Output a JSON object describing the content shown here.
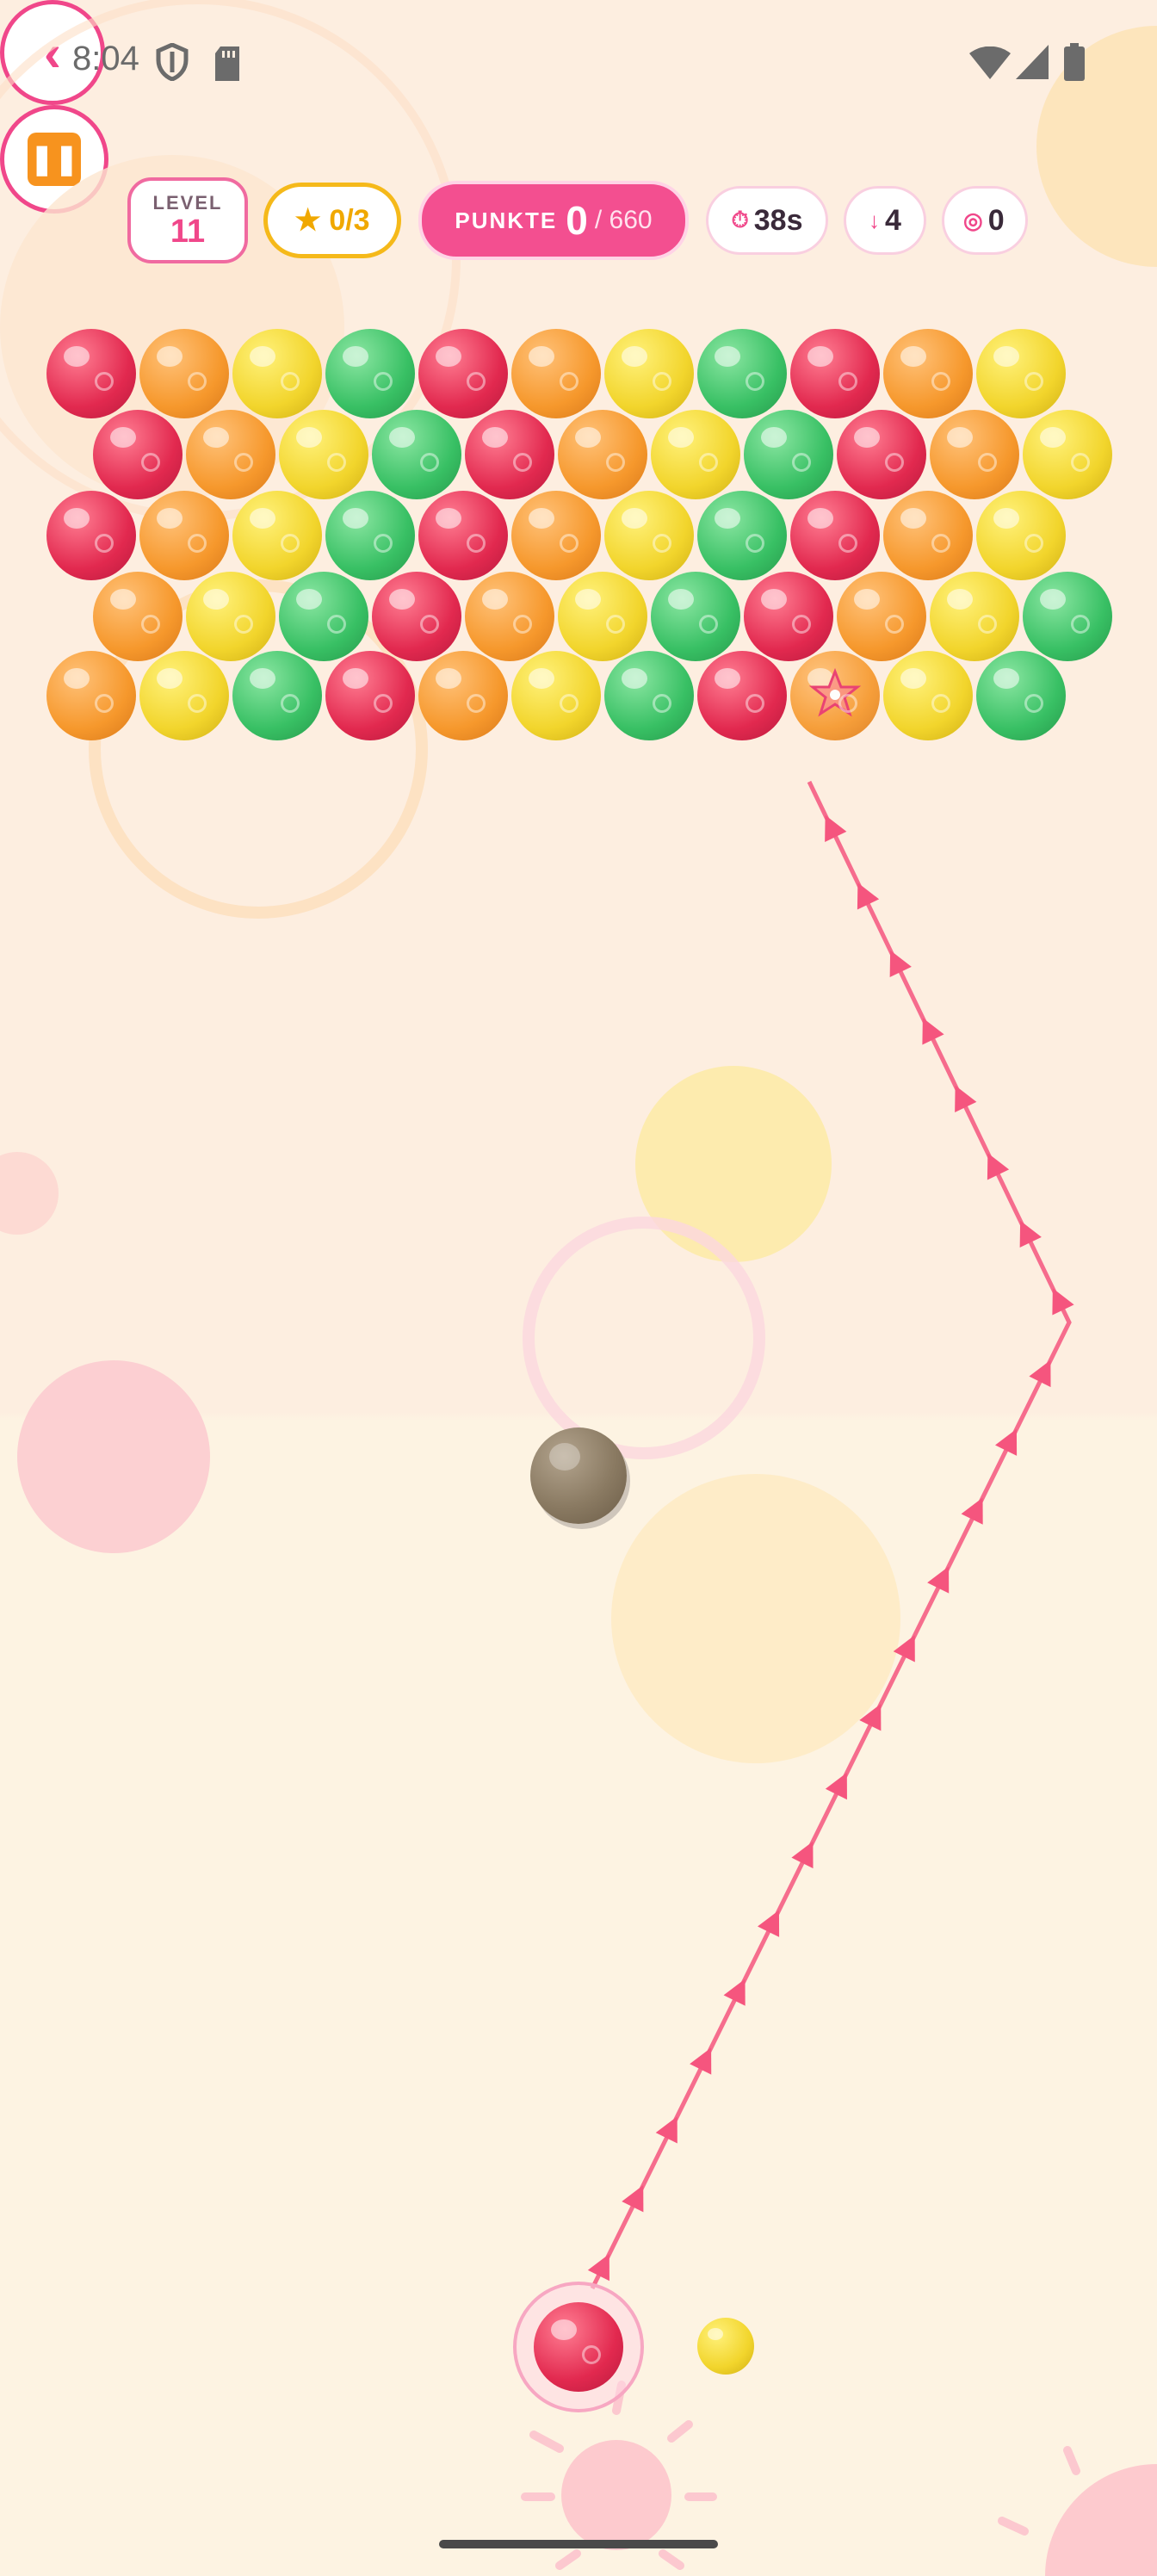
{
  "status_bar": {
    "time": "8:04",
    "icons": [
      "shield-icon",
      "sd-card-icon",
      "wifi-icon",
      "signal-icon",
      "battery-icon"
    ]
  },
  "hud": {
    "back_label": "‹",
    "level_label": "LEVEL",
    "level_value": "11",
    "stars": "★ 0/3",
    "score_label": "PUNKTE",
    "score_value": "0",
    "score_target": "/ 660",
    "timer": "38s",
    "timer_icon": "stopwatch-icon",
    "drops": "4",
    "drops_icon": "arrow-down-icon",
    "targets": "0",
    "targets_icon": "target-icon",
    "pause_icon": "pause-icon"
  },
  "colors": {
    "red": "#e2294f",
    "orange": "#f6982c",
    "yellow": "#f2d52c",
    "green": "#38c064",
    "accent": "#f0478a",
    "background": "#fdeee0"
  },
  "grid": {
    "rows": [
      [
        "red",
        "orange",
        "yellow",
        "green",
        "red",
        "orange",
        "yellow",
        "green",
        "red",
        "orange",
        "yellow"
      ],
      [
        "red",
        "orange",
        "yellow",
        "green",
        "red",
        "orange",
        "yellow",
        "green",
        "red",
        "orange",
        "yellow"
      ],
      [
        "red",
        "orange",
        "yellow",
        "green",
        "red",
        "orange",
        "yellow",
        "green",
        "red",
        "orange",
        "yellow"
      ],
      [
        "orange",
        "yellow",
        "green",
        "red",
        "orange",
        "yellow",
        "green",
        "red",
        "orange",
        "yellow",
        "green"
      ],
      [
        "orange",
        "yellow",
        "green",
        "red",
        "orange",
        "yellow",
        "green",
        "red",
        "orange-star",
        "yellow",
        "green"
      ]
    ],
    "special_bubble_icon": "star-icon"
  },
  "shooter": {
    "current": "red",
    "next": "yellow"
  },
  "obstacle": "rock-bubble"
}
